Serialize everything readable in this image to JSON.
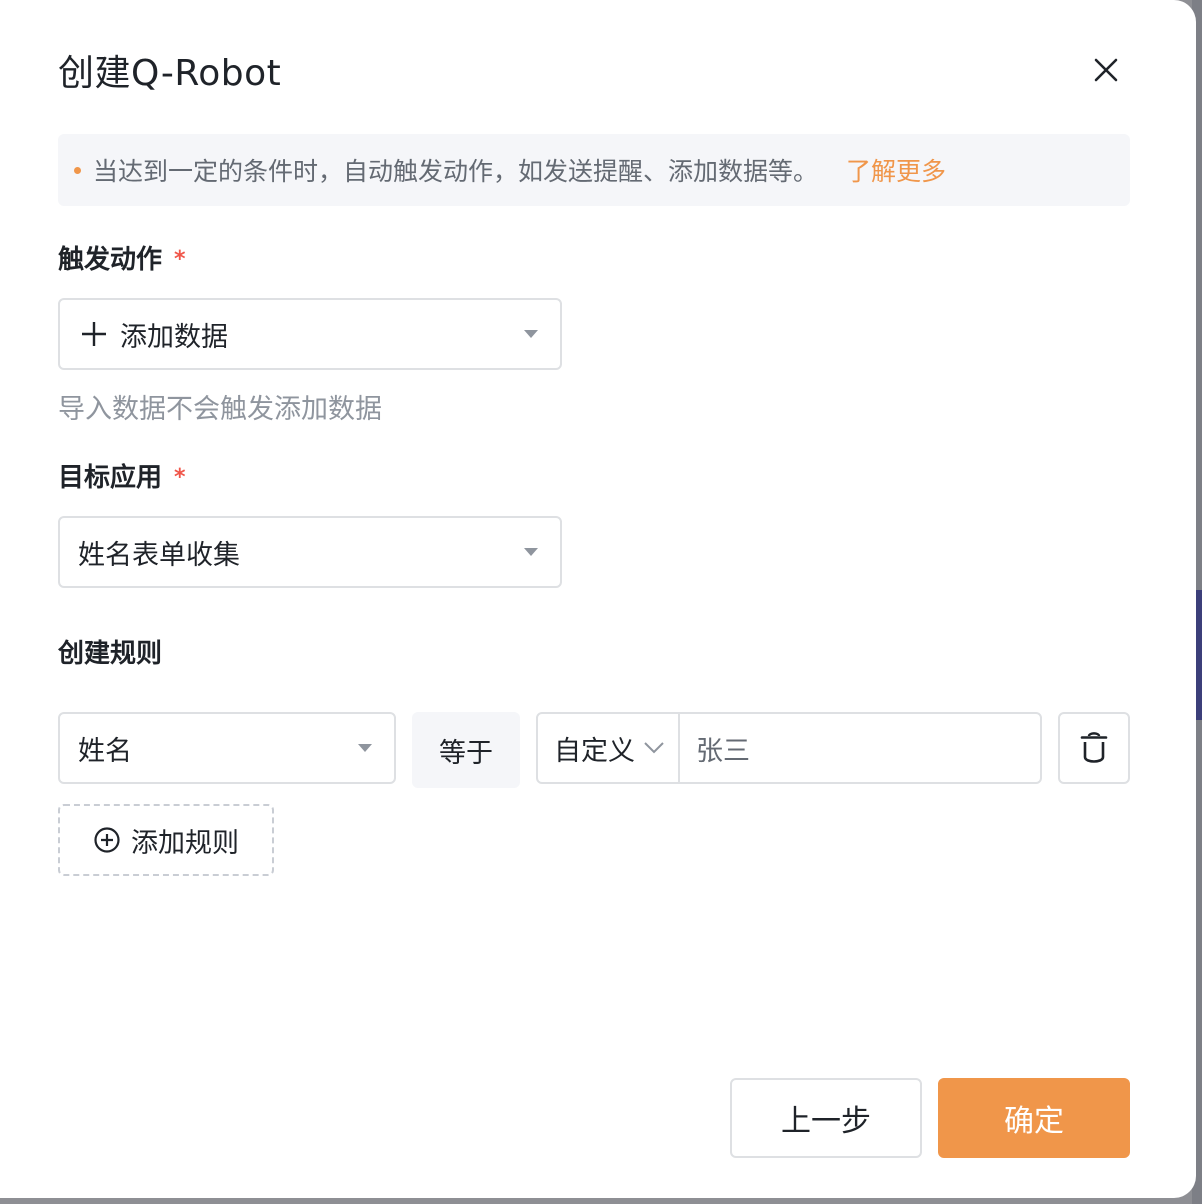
{
  "dialog": {
    "title": "创建Q-Robot"
  },
  "notice": {
    "text": "当达到一定的条件时，自动触发动作，如发送提醒、添加数据等。",
    "link": "了解更多"
  },
  "trigger": {
    "label": "触发动作",
    "required_mark": "*",
    "selected": "添加数据",
    "icon": "plus-icon",
    "helper": "导入数据不会触发添加数据"
  },
  "target_app": {
    "label": "目标应用",
    "required_mark": "*",
    "selected": "姓名表单收集"
  },
  "rules": {
    "label": "创建规则",
    "items": [
      {
        "field": "姓名",
        "operator": "等于",
        "value_type": "自定义",
        "value": "张三"
      }
    ],
    "add_label": "添加规则"
  },
  "footer": {
    "prev_label": "上一步",
    "confirm_label": "确定"
  },
  "colors": {
    "accent": "#f0964a",
    "required": "#f0564a",
    "border": "#dee0e3",
    "muted_text": "#8f959e"
  }
}
